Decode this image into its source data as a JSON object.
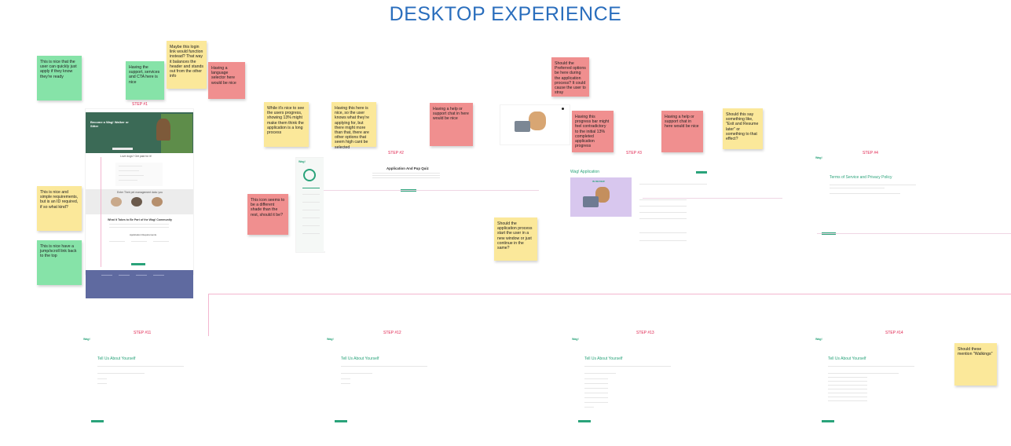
{
  "page": {
    "title": "DESKTOP EXPERIENCE"
  },
  "steps": {
    "s1": "STEP #1",
    "s2": "STEP #2",
    "s3": "STEP #3",
    "s4": "STEP #4",
    "s11": "STEP #11",
    "s12": "STEP #12",
    "s13": "STEP #13",
    "s14": "STEP #14"
  },
  "notes": {
    "n1": "This is nice that the user can quickly just apply if they know they're ready",
    "n2": "Having the support, services and CTA here is nice",
    "n3": "Maybe this login link would function instead? That way it balances the header and stands out from the other info",
    "n4": "Having a language selector here would be nice",
    "n5": "This is nice and simple requirements, but is an ID required, if so what kind?",
    "n6": "This is nice have a jump/scroll link back to the top",
    "n7": "While it's nice to see the users progress, showing 13% might make them think the application is a long process",
    "n8": "Having this here is nice, so the user knows what they're applying for, but there might more than that, there are other options that seem high cant be selected",
    "n9": "Having a help or support chat in here would be nice",
    "n10": "This icon seems to be a different shade than the rest, should it be?",
    "n11": "Should the application process start the user in a new window or just continue in the same?",
    "n12": "Should the Preferred options be here during the application process? It could cause the user to stray",
    "n13": "Having this progress bar might feel contradictory to the initial 13% completed application progress",
    "n14": "Having a help or support chat in here would be nice",
    "n15": "Should this say something like, \"Exit and Resume later\" or something to that effect?",
    "n16": "Should these mention \"Walkings\""
  },
  "screens": {
    "s1_hero": "Become a Wag! Walker or Sitter",
    "s1_love": "Love dogs? Get paid for it!",
    "s1_share": "Enter Their pet management data: you",
    "s1_part": "What It Takes to Be Part of the Wag! Community",
    "s1_req": "Application Requirements",
    "s2_heading": "Application And Pup Quiz",
    "s3_heading": "Wag! Application",
    "s3_badge": "IN REVIEW",
    "s4_heading": "Terms of Service and Privacy Policy",
    "tell": "Tell Us About Yourself",
    "logo": "Wag!"
  }
}
